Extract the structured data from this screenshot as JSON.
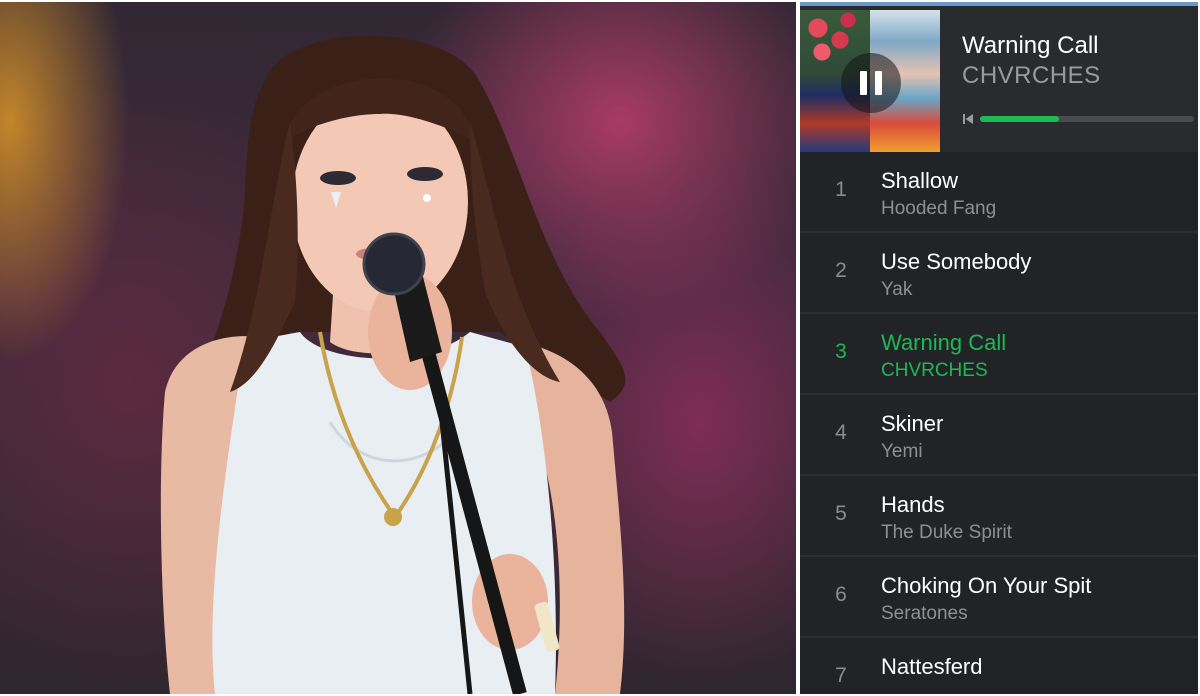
{
  "now_playing": {
    "title": "Warning Call",
    "artist": "CHVRCHES",
    "progress": 0.37,
    "controls": {
      "play_pause_icon": "pause-icon",
      "previous_icon": "skip-previous-icon"
    }
  },
  "tracks": [
    {
      "number": "1",
      "title": "Shallow",
      "artist": "Hooded Fang",
      "active": false
    },
    {
      "number": "2",
      "title": "Use Somebody",
      "artist": "Yak",
      "active": false
    },
    {
      "number": "3",
      "title": "Warning Call",
      "artist": "CHVRCHES",
      "active": true
    },
    {
      "number": "4",
      "title": "Skiner",
      "artist": "Yemi",
      "active": false
    },
    {
      "number": "5",
      "title": "Hands",
      "artist": "The Duke Spirit",
      "active": false
    },
    {
      "number": "6",
      "title": "Choking On Your Spit",
      "artist": "Seratones",
      "active": false
    },
    {
      "number": "7",
      "title": "Nattesferd",
      "artist": "",
      "active": false
    }
  ],
  "colors": {
    "accent": "#1db954",
    "panel_bg": "#222326",
    "text_primary": "#ffffff",
    "text_secondary": "#8f8f8f"
  }
}
